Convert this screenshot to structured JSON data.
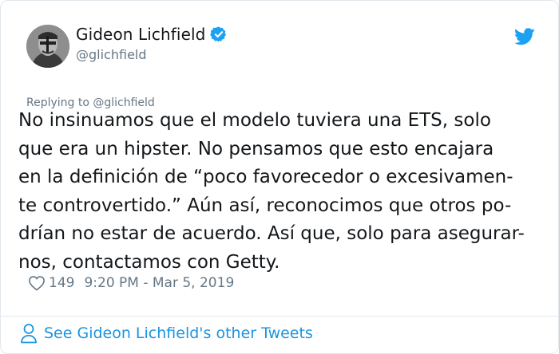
{
  "author": {
    "name": "Gideon Lichfield",
    "handle": "@glichfield"
  },
  "tweet": {
    "replying_to": "Replying to @glichfield",
    "text": "No insinuamos que el modelo tuviera una ETS, solo\nque era un hipster. No pensamos que esto encajara\nen la definición de “poco favorecedor o excesivamen-\nte controvertido.” Aún así, reconocimos que otros po-\ndrían no estar de acuerdo. Así que, solo para asegurar-\nnos, contactamos con Getty.",
    "likes": "149",
    "timestamp": "9:20 PM - Mar 5, 2019"
  },
  "footer": {
    "link_text": "See Gideon Lichfield's other Tweets"
  },
  "icons": {
    "verified": "verified-badge-icon",
    "platform": "twitter-bird-icon",
    "like": "heart-icon",
    "profile": "person-icon"
  },
  "colors": {
    "accent": "#1da1f2",
    "link": "#1b95e0",
    "secondary_text": "#657786",
    "border": "#e1e8ed"
  }
}
